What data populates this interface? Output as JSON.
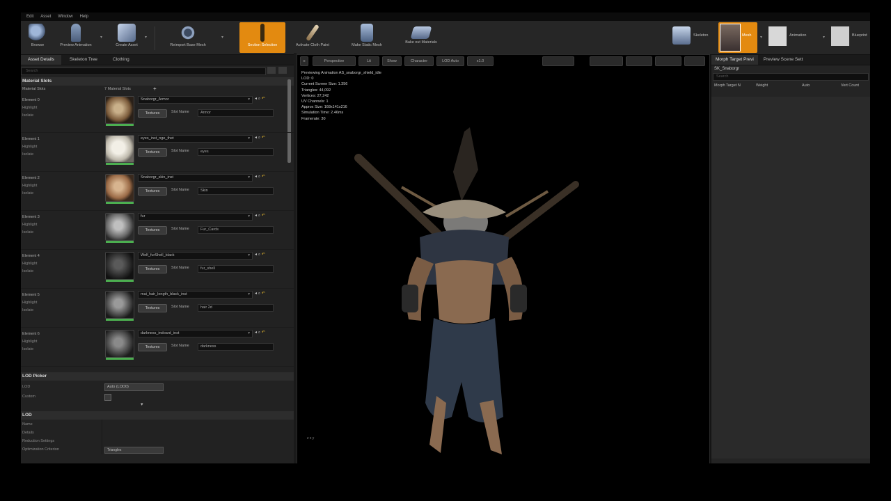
{
  "menubar": [
    "Edit",
    "Asset",
    "Window",
    "Help"
  ],
  "toolbar": {
    "buttons": [
      {
        "label": "Browse",
        "icon": "browse-icon"
      },
      {
        "label": "Preview Animation",
        "icon": "running-figure-icon"
      },
      {
        "label": "Create Asset",
        "icon": "create-asset-icon"
      },
      {
        "label": "Reimport Base Mesh",
        "icon": "reimport-icon"
      },
      {
        "label": "Section Selection",
        "icon": "section-selection-icon"
      },
      {
        "label": "Activate Cloth Paint",
        "icon": "paint-brush-icon"
      },
      {
        "label": "Make Static Mesh",
        "icon": "static-mesh-icon"
      },
      {
        "label": "Bake out Materials",
        "icon": "bake-icon"
      }
    ],
    "modes": [
      {
        "label": "Skeleton"
      },
      {
        "label": "Mesh"
      },
      {
        "label": "Animation"
      },
      {
        "label": "Blueprint"
      }
    ]
  },
  "left_panel": {
    "tabs": [
      "Asset Details",
      "Skeleton Tree",
      "Clothing"
    ],
    "search_placeholder": "Search",
    "sections": {
      "material_slots": "Material Slots",
      "material_slots_row": "Material Slots",
      "material_slots_count": "7 Material Slots",
      "lod_picker": "LOD Picker",
      "lod": "LOD"
    },
    "slots": [
      {
        "title": "Element 0",
        "highlight": "Highlight",
        "isolate": "Isolate",
        "material": "Snaborgr_Armor",
        "slot_name": "Armor"
      },
      {
        "title": "Element 1",
        "highlight": "Highlight",
        "isolate": "Isolate",
        "material": "eyes_inst_nge_thet",
        "slot_name": "eyes"
      },
      {
        "title": "Element 2",
        "highlight": "Highlight",
        "isolate": "Isolate",
        "material": "Snaborgr_skin_inst",
        "slot_name": "Skin"
      },
      {
        "title": "Element 3",
        "highlight": "Highlight",
        "isolate": "Isolate",
        "material": "fur",
        "slot_name": "Fur_Cards"
      },
      {
        "title": "Element 4",
        "highlight": "Highlight",
        "isolate": "Isolate",
        "material": "Wolf_furShell_black",
        "slot_name": "fur_shell"
      },
      {
        "title": "Element 5",
        "highlight": "Highlight",
        "isolate": "Isolate",
        "material": "mai_hair_length_black_inst",
        "slot_name": "hair 2d"
      },
      {
        "title": "Element 6",
        "highlight": "Highlight",
        "isolate": "Isolate",
        "material": "darkness_indoard_inst",
        "slot_name": "darkness"
      }
    ],
    "textures_label": "Textures",
    "lod_picker_rows": [
      {
        "label": "LOD",
        "value": "Auto (LOD0)"
      },
      {
        "label": "Custom",
        "value": ""
      }
    ],
    "lod_rows": [
      "Name",
      "Details",
      "Reduction Settings",
      "Optimization Criterion"
    ],
    "lod_dropdown": "Triangles"
  },
  "viewport": {
    "toolbar": [
      "Perspective",
      "Lit",
      "Show",
      "Character",
      "LOD Auto",
      "x1.0"
    ],
    "info": [
      "Previewing Animation AS_snaborgr_shield_idle",
      "LOD: 0",
      "Current Screen Size: 1.356",
      "Triangles: 44,092",
      "Vertices: 27,242",
      "UV Channels: 1",
      "Approx Size: 168x141x216",
      "Simulation Time: 2.46ms",
      "Framerate: 30"
    ],
    "axes": "z x y"
  },
  "right_panel": {
    "tabs": [
      "Morph Target Previ",
      "Preview Scene Sett"
    ],
    "asset_label": "SK_Snaborgr",
    "search_placeholder": "Search",
    "columns": [
      "Morph Target N",
      "Weight",
      "Auto",
      "Vert Count"
    ]
  }
}
